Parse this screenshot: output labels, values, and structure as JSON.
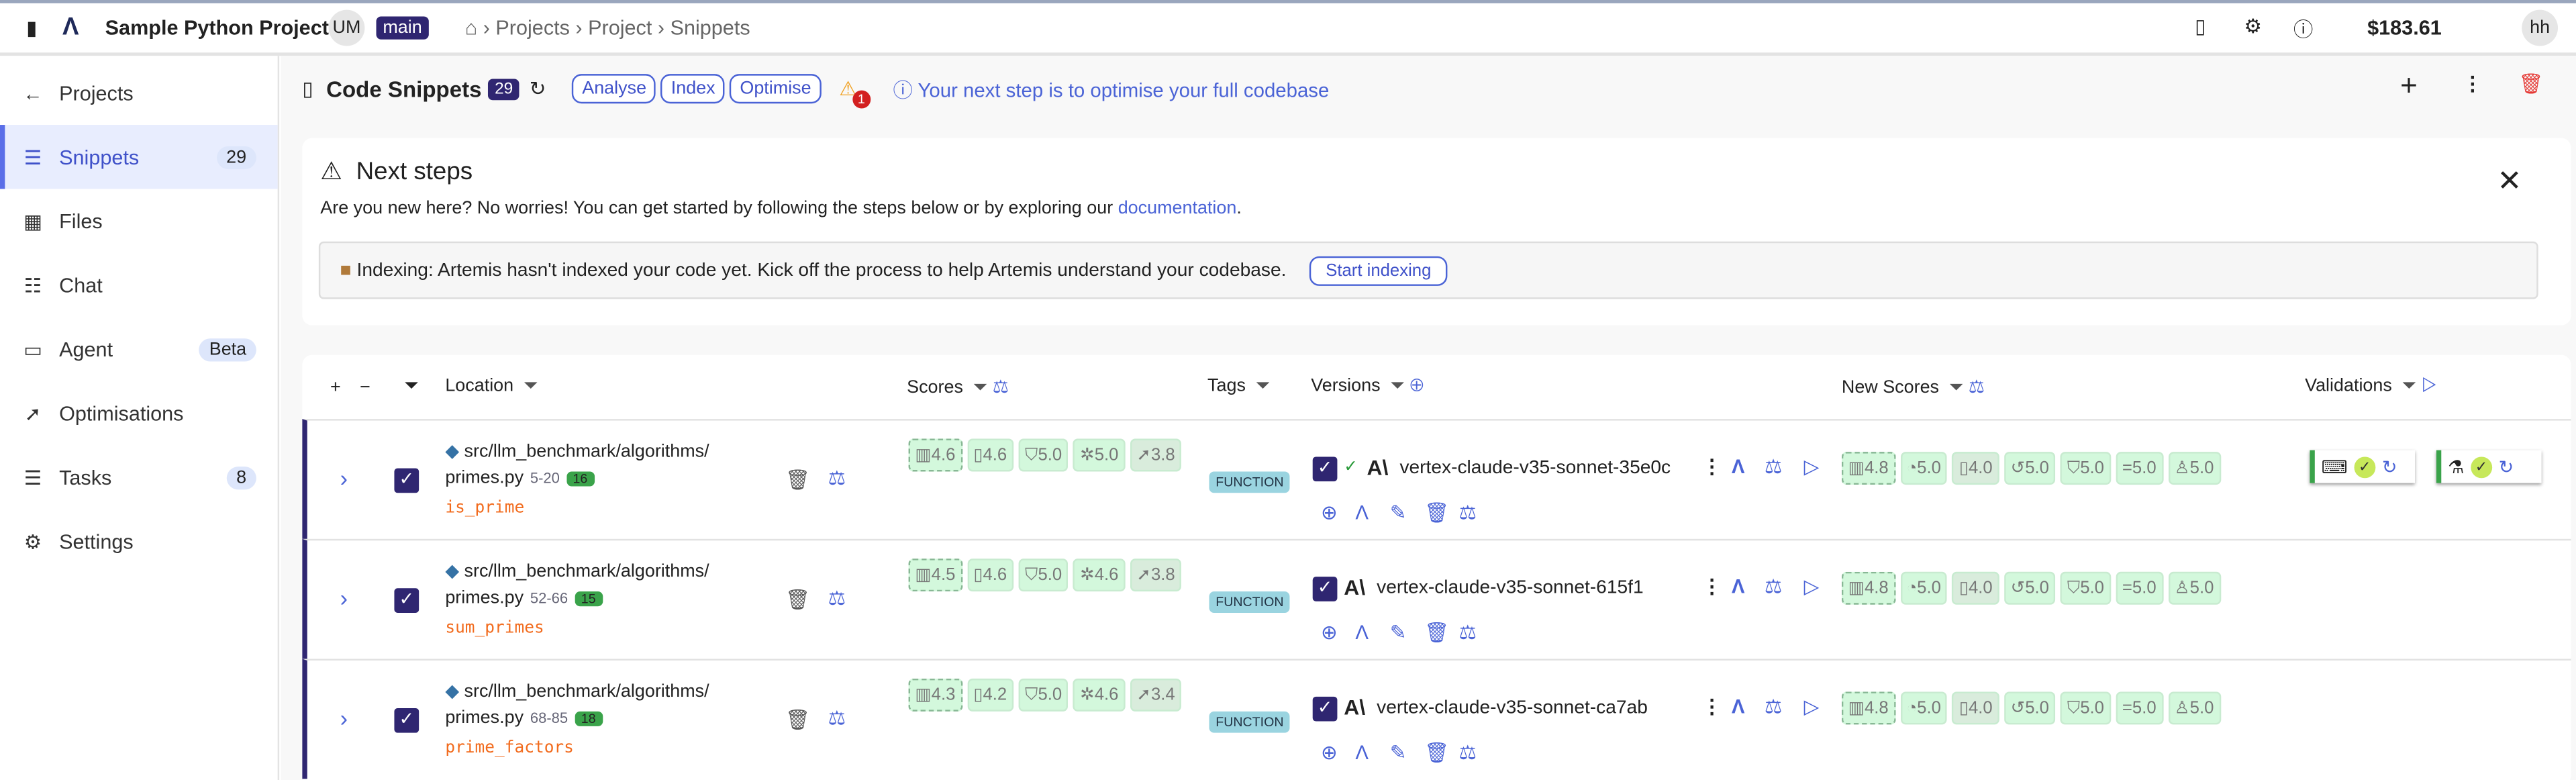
{
  "topbar": {
    "project": "Sample Python Project",
    "avatar": "UM",
    "branch": "main",
    "breadcrumb": [
      "Projects",
      "Project",
      "Snippets"
    ],
    "balance": "$183.61",
    "user": "hh"
  },
  "sidebar": {
    "back": "Projects",
    "items": [
      {
        "label": "Snippets",
        "icon": "snippets-icon",
        "badge": "29",
        "active": true
      },
      {
        "label": "Files",
        "icon": "files-icon"
      },
      {
        "label": "Chat",
        "icon": "chat-icon"
      },
      {
        "label": "Agent",
        "icon": "agent-icon",
        "badge": "Beta"
      },
      {
        "label": "Optimisations",
        "icon": "rocket-icon"
      },
      {
        "label": "Tasks",
        "icon": "tasks-icon",
        "badge": "8"
      },
      {
        "label": "Settings",
        "icon": "gear-icon"
      }
    ]
  },
  "header": {
    "title": "Code Snippets",
    "count": "29",
    "buttons": [
      "Analyse",
      "Index",
      "Optimise"
    ],
    "warning_count": "1",
    "hint": "Your next step is to optimise your full codebase"
  },
  "next_steps": {
    "title": "Next steps",
    "intro": "Are you new here? No worries! You can get started by following the steps below or by exploring our",
    "link": "documentation",
    "indexing": "Indexing: Artemis hasn't indexed your code yet. Kick off the process to help Artemis understand your codebase.",
    "start_button": "Start indexing"
  },
  "table": {
    "columns": {
      "location": "Location",
      "scores": "Scores",
      "tags": "Tags",
      "versions": "Versions",
      "new_scores": "New Scores",
      "validations": "Validations"
    },
    "rows": [
      {
        "path": "src/llm_benchmark/algorithms/",
        "file": "primes.py",
        "lines": "5-20",
        "count": "16",
        "name": "is_prime",
        "scores": [
          "4.6",
          "4.6",
          "5.0",
          "5.0",
          "3.8"
        ],
        "tag": "FUNCTION",
        "version": "vertex-claude-v35-sonnet-35e0c",
        "verified": true,
        "new_scores": [
          "4.8",
          "5.0",
          "4.0",
          "5.0",
          "5.0",
          "5.0",
          "5.0"
        ],
        "validations": true
      },
      {
        "path": "src/llm_benchmark/algorithms/",
        "file": "primes.py",
        "lines": "52-66",
        "count": "15",
        "name": "sum_primes",
        "scores": [
          "4.5",
          "4.6",
          "5.0",
          "4.6",
          "3.8"
        ],
        "tag": "FUNCTION",
        "version": "vertex-claude-v35-sonnet-615f1",
        "verified": false,
        "new_scores": [
          "4.8",
          "5.0",
          "4.0",
          "5.0",
          "5.0",
          "5.0",
          "5.0"
        ],
        "validations": false
      },
      {
        "path": "src/llm_benchmark/algorithms/",
        "file": "primes.py",
        "lines": "68-85",
        "count": "18",
        "name": "prime_factors",
        "scores": [
          "4.3",
          "4.2",
          "5.0",
          "4.6",
          "3.4"
        ],
        "tag": "FUNCTION",
        "version": "vertex-claude-v35-sonnet-ca7ab",
        "verified": false,
        "new_scores": [
          "4.8",
          "5.0",
          "4.0",
          "5.0",
          "5.0",
          "5.0",
          "5.0"
        ],
        "validations": false
      }
    ]
  },
  "colors": {
    "accent": "#4a63d6",
    "brand": "#2f2671",
    "function_name": "#f26b1d",
    "score_bg": "#d3f8dc",
    "delete": "#e53935"
  }
}
